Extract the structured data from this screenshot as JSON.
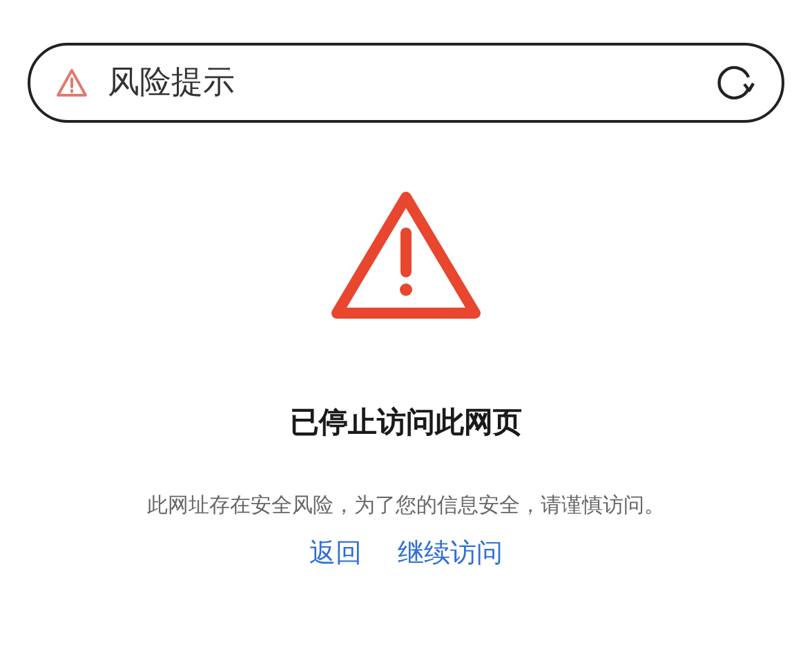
{
  "address_bar": {
    "title": "风险提示"
  },
  "warning": {
    "heading": "已停止访问此网页",
    "message": "此网址存在安全风险，为了您的信息安全，请谨慎访问。"
  },
  "links": [
    "返回",
    "继续访问"
  ]
}
